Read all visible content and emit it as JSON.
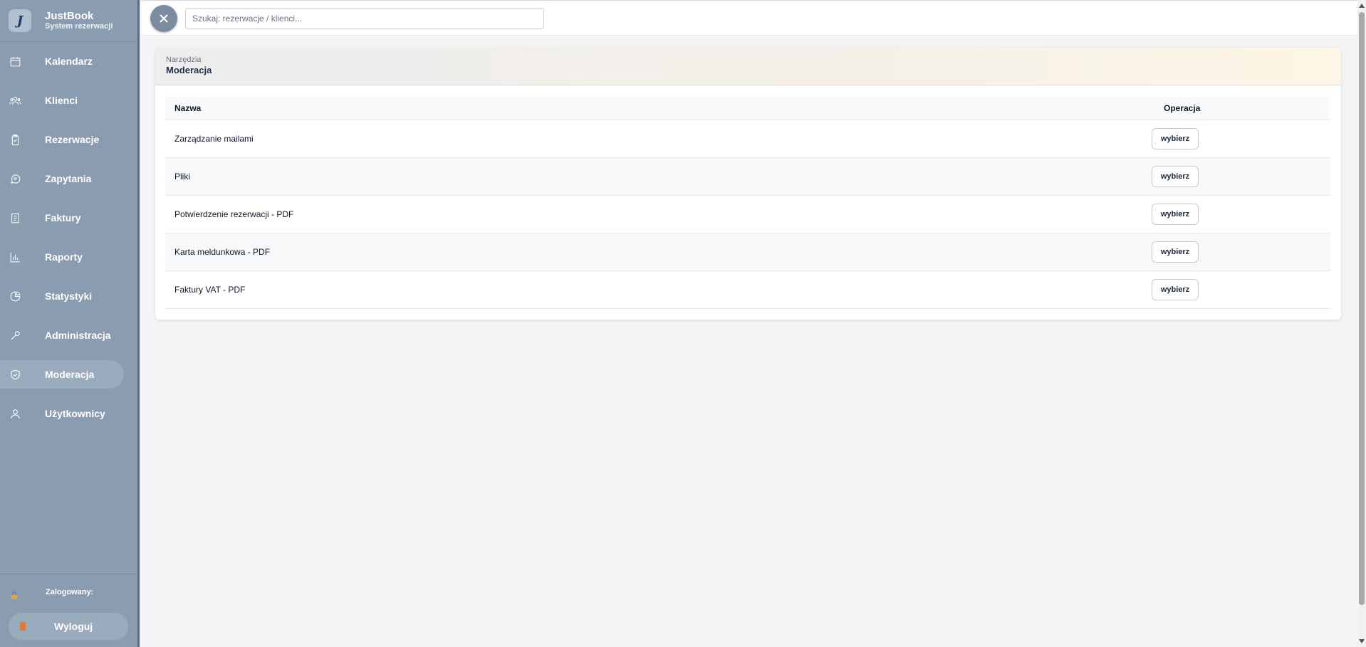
{
  "brand": {
    "logo_letter": "J",
    "name": "JustBook",
    "subtitle": "System rezerwacji"
  },
  "sidebar": {
    "items": [
      {
        "label": "Kalendarz",
        "icon": "calendar-icon",
        "active": false
      },
      {
        "label": "Klienci",
        "icon": "users-icon",
        "active": false
      },
      {
        "label": "Rezerwacje",
        "icon": "clipboard-check-icon",
        "active": false
      },
      {
        "label": "Zapytania",
        "icon": "chat-icon",
        "active": false
      },
      {
        "label": "Faktury",
        "icon": "document-icon",
        "active": false
      },
      {
        "label": "Raporty",
        "icon": "bar-chart-icon",
        "active": false
      },
      {
        "label": "Statystyki",
        "icon": "pie-chart-icon",
        "active": false
      },
      {
        "label": "Administracja",
        "icon": "wrench-icon",
        "active": false
      },
      {
        "label": "Moderacja",
        "icon": "shield-check-icon",
        "active": true
      },
      {
        "label": "Użytkownicy",
        "icon": "user-icon",
        "active": false
      }
    ],
    "logged_label": "Zalogowany:",
    "logout_label": "Wyloguj"
  },
  "topbar": {
    "search_placeholder": "Szukaj: rezerwacje / klienci..."
  },
  "card": {
    "breadcrumb": "Narzędzia",
    "title": "Moderacja",
    "columns": {
      "name": "Nazwa",
      "operation": "Operacja"
    },
    "rows": [
      {
        "name": "Zarządzanie mailami",
        "action": "wybierz"
      },
      {
        "name": "Pliki",
        "action": "wybierz"
      },
      {
        "name": "Potwierdzenie rezerwacji - PDF",
        "action": "wybierz"
      },
      {
        "name": "Karta meldunkowa - PDF",
        "action": "wybierz"
      },
      {
        "name": "Faktury VAT - PDF",
        "action": "wybierz"
      }
    ]
  },
  "colors": {
    "sidebar": "#8a9cb0",
    "accent": "#1f2d4a",
    "logout_icon": "#e07b39"
  }
}
